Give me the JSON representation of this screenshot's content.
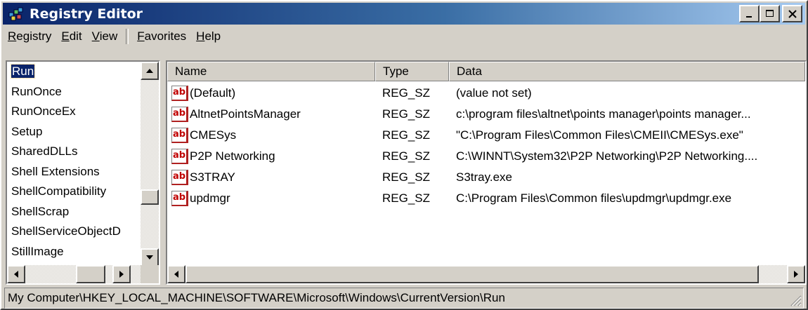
{
  "window": {
    "title": "Registry Editor"
  },
  "menu": [
    {
      "pre": "",
      "u": "R",
      "post": "egistry"
    },
    {
      "pre": "",
      "u": "E",
      "post": "dit"
    },
    {
      "pre": "",
      "u": "V",
      "post": "iew"
    },
    {
      "pre": "",
      "u": "F",
      "post": "avorites"
    },
    {
      "pre": "",
      "u": "H",
      "post": "elp"
    }
  ],
  "tree": {
    "items": [
      "Run",
      "RunOnce",
      "RunOnceEx",
      "Setup",
      "SharedDLLs",
      "Shell Extensions",
      "ShellCompatibility",
      "ShellScrap",
      "ShellServiceObjectD",
      "StillImage"
    ],
    "selected_index": 0
  },
  "list": {
    "headers": {
      "name": "Name",
      "type": "Type",
      "data": "Data"
    },
    "icon_name": "reg-sz-icon",
    "icon_text": "ab",
    "rows": [
      {
        "name": "(Default)",
        "type": "REG_SZ",
        "data": "(value not set)"
      },
      {
        "name": "AltnetPointsManager",
        "type": "REG_SZ",
        "data": "c:\\program files\\altnet\\points manager\\points manager..."
      },
      {
        "name": "CMESys",
        "type": "REG_SZ",
        "data": "\"C:\\Program Files\\Common Files\\CMEII\\CMESys.exe\""
      },
      {
        "name": "P2P Networking",
        "type": "REG_SZ",
        "data": "C:\\WINNT\\System32\\P2P Networking\\P2P Networking...."
      },
      {
        "name": "S3TRAY",
        "type": "REG_SZ",
        "data": "S3tray.exe"
      },
      {
        "name": "updmgr",
        "type": "REG_SZ",
        "data": "C:\\Program Files\\Common files\\updmgr\\updmgr.exe"
      }
    ]
  },
  "status": {
    "path": "My Computer\\HKEY_LOCAL_MACHINE\\SOFTWARE\\Microsoft\\Windows\\CurrentVersion\\Run"
  },
  "colors": {
    "titlebar_start": "#0a246a",
    "titlebar_end": "#a6caf0",
    "face": "#d4d0c8",
    "selection": "#0a246a",
    "icon_red": "#c00000"
  }
}
